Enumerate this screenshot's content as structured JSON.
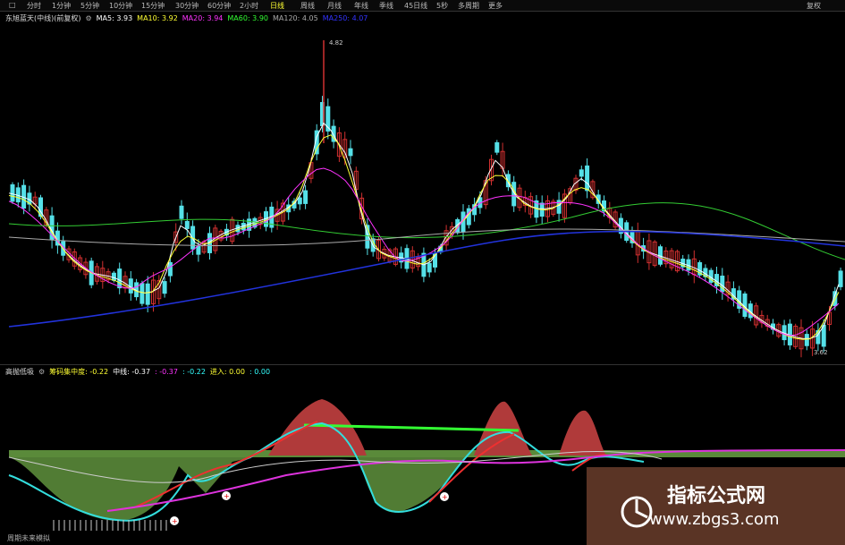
{
  "toolbar": {
    "items": [
      "□",
      "分时",
      "1分钟",
      "5分钟",
      "10分钟",
      "15分钟",
      "30分钟",
      "60分钟",
      "2小时",
      "日线",
      "周线",
      "月线",
      "年线",
      "季线",
      "45日线",
      "5秒",
      "多周期",
      "更多"
    ],
    "active_index": 9,
    "right": "复权"
  },
  "main_legend": {
    "title": "东旭蓝天(中线)(前复权)",
    "items": [
      {
        "text": "MA5: 3.93",
        "color": "#ffffff"
      },
      {
        "text": "MA10: 3.92",
        "color": "#ffff33"
      },
      {
        "text": "MA20: 3.94",
        "color": "#ff33ff"
      },
      {
        "text": "MA60: 3.90",
        "color": "#33ff33"
      },
      {
        "text": "MA120: 4.05",
        "color": "#aaaaaa"
      },
      {
        "text": "MA250: 4.07",
        "color": "#3333ff"
      }
    ]
  },
  "price_labels": {
    "high": "4.82",
    "low": "3.62"
  },
  "sub_legend": {
    "title": "高抛低吸",
    "items": [
      {
        "text": "筹码集中度: -0.22",
        "color": "#ffff33"
      },
      {
        "text": "中线: -0.37",
        "color": "#ffffff"
      },
      {
        "text": ": -0.37",
        "color": "#ff33ff"
      },
      {
        "text": ": -0.22",
        "color": "#33ffff"
      },
      {
        "text": "进入: 0.00",
        "color": "#ffff33"
      },
      {
        "text": ": 0.00",
        "color": "#33ffff"
      }
    ]
  },
  "bottom_label": "周期未来模拟",
  "watermark": {
    "title": "指标公式网",
    "url": "www.zbgs3.com"
  },
  "colors": {
    "up": "#d03030",
    "down": "#55e0e8",
    "area_green": "#5a8a3a",
    "area_red": "#b03a3a"
  }
}
